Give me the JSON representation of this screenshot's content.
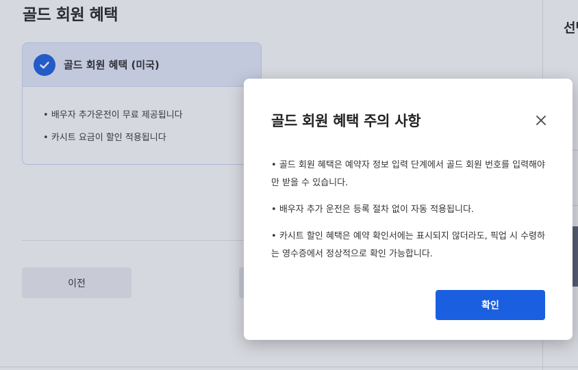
{
  "page": {
    "title": "골드 회원 혜택",
    "benefit_card": {
      "title": "골드 회원 혜택 (미국)",
      "items": [
        "배우자 추가운전이 무료 제공됩니다",
        "카시트 요금이 할인 적용됩니다"
      ]
    },
    "prev_button_label": "이전",
    "side_title": "선택"
  },
  "modal": {
    "title": "골드 회원 혜택 주의 사항",
    "notes": [
      "골드 회원 혜택은 예약자 정보 입력 단계에서 골드 회원 번호를 입력해야만 받을 수 있습니다.",
      "배우자 추가 운전은 등록 절차 없이 자동 적용됩니다.",
      "카시트 할인 혜택은 예약 확인서에는 표시되지 않더라도, 픽업 시 수령하는 영수증에서 정상적으로 확인 가능합니다."
    ],
    "confirm_label": "확인"
  },
  "icons": {
    "check": "check-circle-icon",
    "close": "close-icon"
  },
  "colors": {
    "accent": "#1a5fe0",
    "card_header_bg": "#e6ecfd",
    "overlay": "rgba(70,78,110,0.22)"
  }
}
